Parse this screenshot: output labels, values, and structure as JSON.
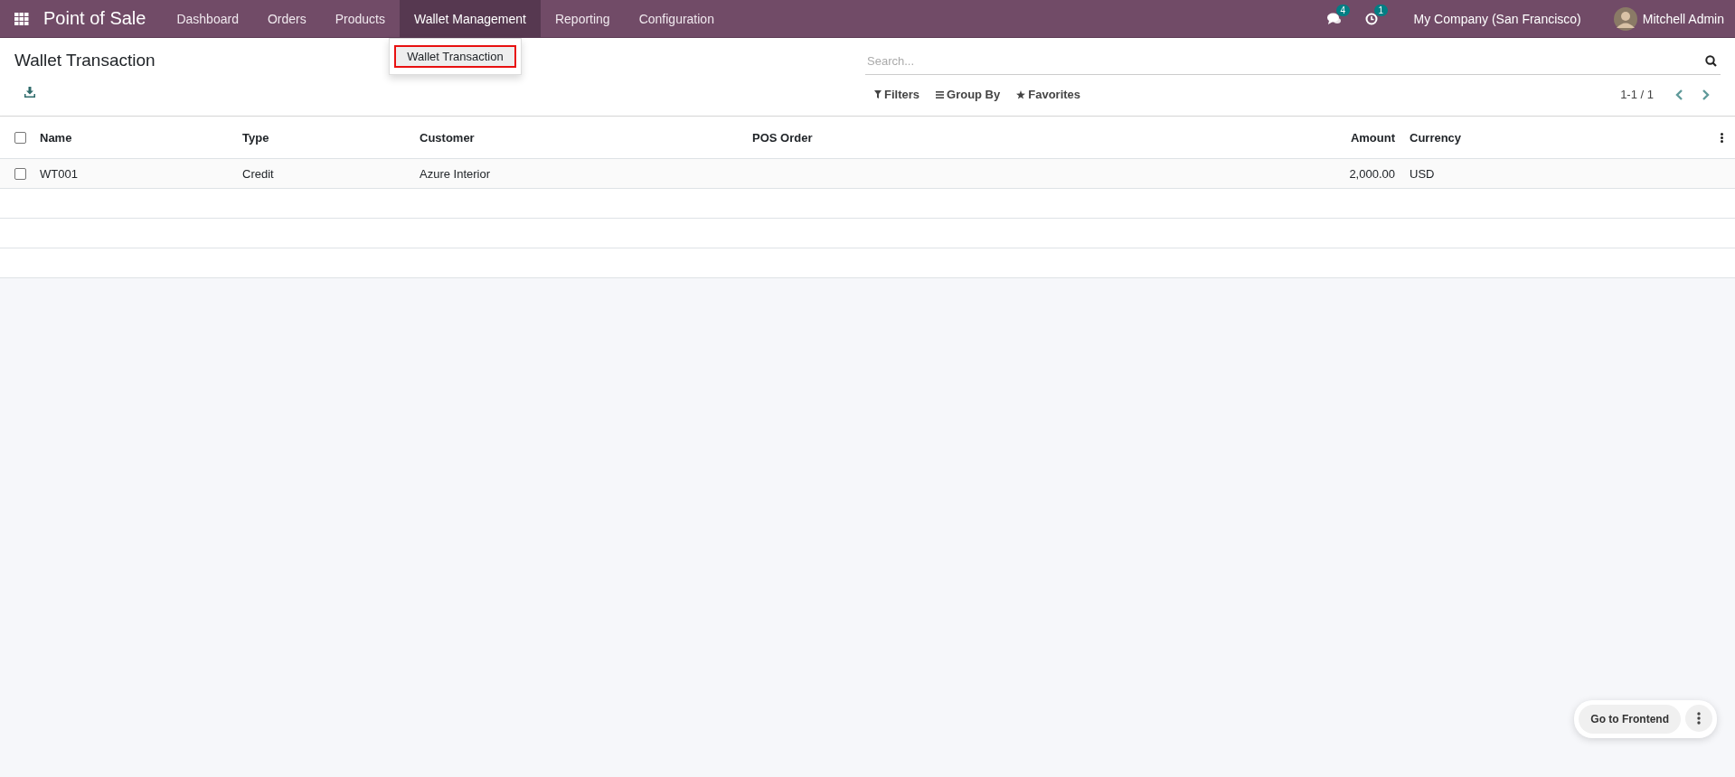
{
  "navbar": {
    "app_name": "Point of Sale",
    "menu": [
      {
        "label": "Dashboard",
        "selected": false
      },
      {
        "label": "Orders",
        "selected": false
      },
      {
        "label": "Products",
        "selected": false
      },
      {
        "label": "Wallet Management",
        "selected": true
      },
      {
        "label": "Reporting",
        "selected": false
      },
      {
        "label": "Configuration",
        "selected": false
      }
    ],
    "messages_count": "4",
    "activities_count": "1",
    "company": "My Company (San Francisco)",
    "user": "Mitchell Admin"
  },
  "dropdown": {
    "items": [
      {
        "label": "Wallet Transaction",
        "selected": true
      }
    ]
  },
  "page_title": "Wallet Transaction",
  "search": {
    "placeholder": "Search..."
  },
  "filters": [
    {
      "label": "Filters",
      "kind": "filter"
    },
    {
      "label": "Group By",
      "kind": "group"
    },
    {
      "label": "Favorites",
      "kind": "star"
    }
  ],
  "pager": "1-1 / 1",
  "table": {
    "all_selected": false,
    "columns": [
      {
        "label": "Name"
      },
      {
        "label": "Type"
      },
      {
        "label": "Customer"
      },
      {
        "label": "POS Order"
      },
      {
        "label": "Amount"
      },
      {
        "label": "Currency"
      }
    ],
    "rows": [
      {
        "checked": false,
        "cells": [
          "WT001",
          "Credit",
          "Azure Interior",
          "",
          "2,000.00",
          "USD"
        ]
      }
    ]
  },
  "floating_button": "Go to Frontend"
}
